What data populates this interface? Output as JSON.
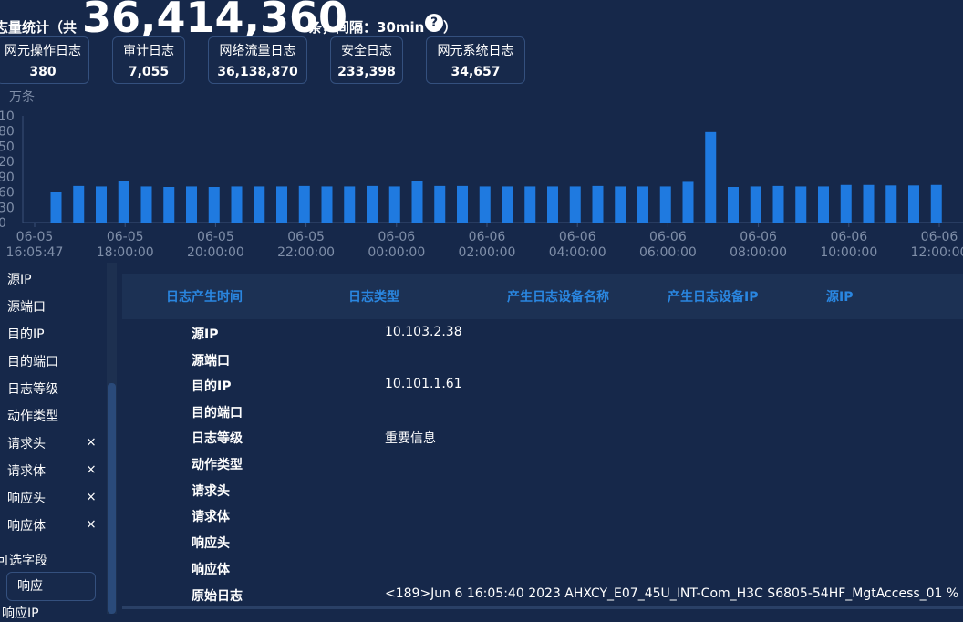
{
  "header": {
    "prefix": "志量统计（共",
    "total": "36,414,360",
    "suffix": "条，间隔：30min",
    "help_glyph": "?",
    "close": "）"
  },
  "stats": [
    {
      "name": "网元操作日志",
      "value": "380"
    },
    {
      "name": "审计日志",
      "value": "7,055"
    },
    {
      "name": "网络流量日志",
      "value": "36,138,870"
    },
    {
      "name": "安全日志",
      "value": "233,398"
    },
    {
      "name": "网元系统日志",
      "value": "34,657"
    }
  ],
  "chart_data": {
    "type": "bar",
    "ylabel": "万条",
    "y_tick_labels": [
      "0",
      "30",
      "60",
      "90",
      "20",
      "50",
      "80",
      "10"
    ],
    "bar_color": "#1f7ae0",
    "x_tick_labels": [
      [
        "06-05",
        "16:05:47"
      ],
      [
        "06-05",
        "18:00:00"
      ],
      [
        "06-05",
        "20:00:00"
      ],
      [
        "06-05",
        "22:00:00"
      ],
      [
        "06-06",
        "00:00:00"
      ],
      [
        "06-06",
        "02:00:00"
      ],
      [
        "06-06",
        "04:00:00"
      ],
      [
        "06-06",
        "06:00:00"
      ],
      [
        "06-06",
        "08:00:00"
      ],
      [
        "06-06",
        "10:00:00"
      ],
      [
        "06-06",
        "12:00:00"
      ]
    ],
    "values": [
      60,
      72,
      71,
      81,
      71,
      70,
      71,
      70,
      71,
      71,
      71,
      72,
      71,
      71,
      72,
      71,
      82,
      72,
      72,
      71,
      71,
      71,
      71,
      71,
      72,
      71,
      71,
      71,
      80,
      178,
      70,
      71,
      72,
      71,
      71,
      74,
      74,
      73,
      73,
      74
    ],
    "ylim": [
      0,
      210
    ]
  },
  "sidebar": {
    "items": [
      {
        "label": "源IP",
        "removable": false
      },
      {
        "label": "源端口",
        "removable": false
      },
      {
        "label": "目的IP",
        "removable": false
      },
      {
        "label": "目的端口",
        "removable": false
      },
      {
        "label": "日志等级",
        "removable": false
      },
      {
        "label": "动作类型",
        "removable": false
      },
      {
        "label": "请求头",
        "removable": true
      },
      {
        "label": "请求体",
        "removable": true
      },
      {
        "label": "响应头",
        "removable": true
      },
      {
        "label": "响应体",
        "removable": true
      }
    ],
    "remove_glyph": "×",
    "optional_section": "可选字段",
    "search_value": "响应",
    "cut_item": "响应IP"
  },
  "table": {
    "columns": [
      "日志产生时间",
      "日志类型",
      "产生日志设备名称",
      "产生日志设备IP",
      "源IP"
    ]
  },
  "detail": [
    {
      "key": "源IP",
      "value": "10.103.2.38"
    },
    {
      "key": "源端口",
      "value": ""
    },
    {
      "key": "目的IP",
      "value": "10.101.1.61"
    },
    {
      "key": "目的端口",
      "value": ""
    },
    {
      "key": "日志等级",
      "value": "重要信息"
    },
    {
      "key": "动作类型",
      "value": ""
    },
    {
      "key": "请求头",
      "value": ""
    },
    {
      "key": "请求体",
      "value": ""
    },
    {
      "key": "响应头",
      "value": ""
    },
    {
      "key": "响应体",
      "value": ""
    },
    {
      "key": "原始日志",
      "value": "<189>Jun  6 16:05:40 2023 AHXCY_E07_45U_INT-Com_H3C S6805-54HF_MgtAccess_01 %"
    }
  ]
}
